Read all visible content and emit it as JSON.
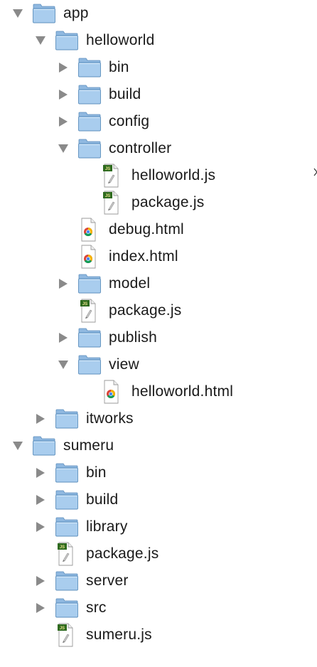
{
  "tree": [
    {
      "label": "app",
      "kind": "folder",
      "depth": 0,
      "expanded": true
    },
    {
      "label": "helloworld",
      "kind": "folder",
      "depth": 1,
      "expanded": true
    },
    {
      "label": "bin",
      "kind": "folder",
      "depth": 2,
      "expanded": false
    },
    {
      "label": "build",
      "kind": "folder",
      "depth": 2,
      "expanded": false
    },
    {
      "label": "config",
      "kind": "folder",
      "depth": 2,
      "expanded": false
    },
    {
      "label": "controller",
      "kind": "folder",
      "depth": 2,
      "expanded": true
    },
    {
      "label": "helloworld.js",
      "kind": "js-file",
      "depth": 3
    },
    {
      "label": "package.js",
      "kind": "js-file",
      "depth": 3
    },
    {
      "label": "debug.html",
      "kind": "html-file",
      "depth": 2
    },
    {
      "label": "index.html",
      "kind": "html-file",
      "depth": 2
    },
    {
      "label": "model",
      "kind": "folder",
      "depth": 2,
      "expanded": false
    },
    {
      "label": "package.js",
      "kind": "js-file",
      "depth": 2
    },
    {
      "label": "publish",
      "kind": "folder",
      "depth": 2,
      "expanded": false
    },
    {
      "label": "view",
      "kind": "folder",
      "depth": 2,
      "expanded": true
    },
    {
      "label": "helloworld.html",
      "kind": "html-file",
      "depth": 3
    },
    {
      "label": "itworks",
      "kind": "folder",
      "depth": 1,
      "expanded": false
    },
    {
      "label": "sumeru",
      "kind": "folder",
      "depth": 0,
      "expanded": true
    },
    {
      "label": "bin",
      "kind": "folder",
      "depth": 1,
      "expanded": false
    },
    {
      "label": "build",
      "kind": "folder",
      "depth": 1,
      "expanded": false
    },
    {
      "label": "library",
      "kind": "folder",
      "depth": 1,
      "expanded": false
    },
    {
      "label": "package.js",
      "kind": "js-file",
      "depth": 1
    },
    {
      "label": "server",
      "kind": "folder",
      "depth": 1,
      "expanded": false
    },
    {
      "label": "src",
      "kind": "folder",
      "depth": 1,
      "expanded": false
    },
    {
      "label": "sumeru.js",
      "kind": "js-file",
      "depth": 1
    }
  ],
  "icons": {
    "folder": "folder-icon",
    "js-file": "js-file-icon",
    "html-file": "html-file-icon",
    "expanded": "disclosure-triangle-down-icon",
    "collapsed": "disclosure-triangle-right-icon",
    "js_badge_text": "JS"
  },
  "colors": {
    "folder_body": "#8fb8e0",
    "folder_front": "#a9cdee",
    "folder_edge": "#5d8fbd",
    "triangle": "#8a8a8a",
    "text": "#1a1a1a",
    "js_badge": "#2f6b1f",
    "js_badge_text": "#e8e18a"
  }
}
